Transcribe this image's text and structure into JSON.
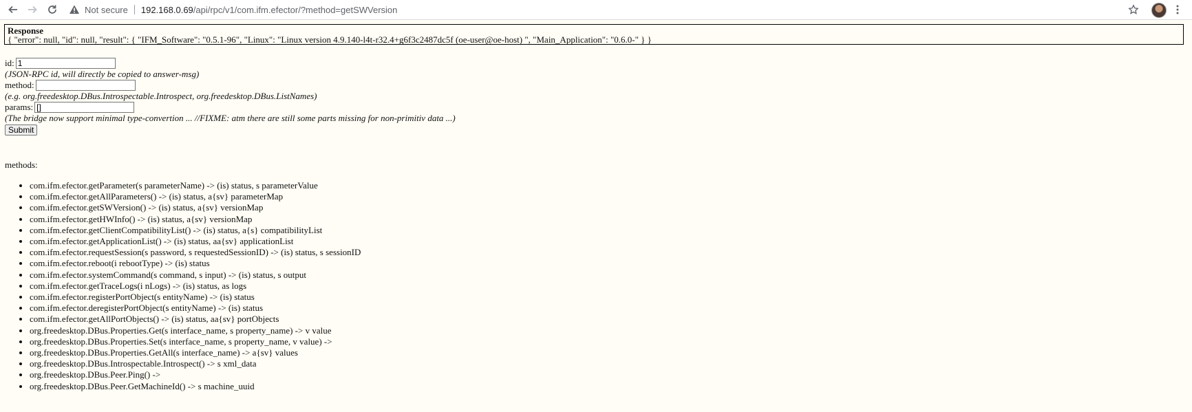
{
  "browser": {
    "security_label": "Not secure",
    "url_host": "192.168.0.69",
    "url_path": "/api/rpc/v1/com.ifm.efector/?method=getSWVersion"
  },
  "response": {
    "title": "Response",
    "body": "{ \"error\": null, \"id\": null, \"result\": { \"IFM_Software\": \"0.5.1-96\", \"Linux\": \"Linux version 4.9.140-l4t-r32.4+g6f3c2487dc5f (oe-user@oe-host) \", \"Main_Application\": \"0.6.0-\" } }"
  },
  "form": {
    "id_label": "id:",
    "id_value": "1",
    "id_hint": "(JSON-RPC id, will directly be copied to answer-msg)",
    "method_label": "method:",
    "method_value": "",
    "method_hint": "(e.g. org.freedesktop.DBus.Introspectable.Introspect, org.freedesktop.DBus.ListNames)",
    "params_label": "params:",
    "params_value": "[]",
    "params_hint": "(The bridge now support minimal type-convertion ... //FIXME: atm there are still some parts missing for non-primitiv data ...)",
    "submit_label": "Submit"
  },
  "methods": {
    "label": "methods:",
    "items": [
      "com.ifm.efector.getParameter(s parameterName) -> (is) status, s parameterValue",
      "com.ifm.efector.getAllParameters() -> (is) status, a{sv} parameterMap",
      "com.ifm.efector.getSWVersion() -> (is) status, a{sv} versionMap",
      "com.ifm.efector.getHWInfo() -> (is) status, a{sv} versionMap",
      "com.ifm.efector.getClientCompatibilityList() -> (is) status, a{s} compatibilityList",
      "com.ifm.efector.getApplicationList() -> (is) status, aa{sv} applicationList",
      "com.ifm.efector.requestSession(s password, s requestedSessionID) -> (is) status, s sessionID",
      "com.ifm.efector.reboot(i rebootType) -> (is) status",
      "com.ifm.efector.systemCommand(s command, s input) -> (is) status, s output",
      "com.ifm.efector.getTraceLogs(i nLogs) -> (is) status, as logs",
      "com.ifm.efector.registerPortObject(s entityName) -> (is) status",
      "com.ifm.efector.deregisterPortObject(s entityName) -> (is) status",
      "com.ifm.efector.getAllPortObjects() -> (is) status, aa{sv} portObjects",
      "org.freedesktop.DBus.Properties.Get(s interface_name, s property_name) -> v value",
      "org.freedesktop.DBus.Properties.Set(s interface_name, s property_name, v value) ->",
      "org.freedesktop.DBus.Properties.GetAll(s interface_name) -> a{sv} values",
      "org.freedesktop.DBus.Introspectable.Introspect() -> s xml_data",
      "org.freedesktop.DBus.Peer.Ping() ->",
      "org.freedesktop.DBus.Peer.GetMachineId() -> s machine_uuid"
    ]
  },
  "icons": {
    "back": "arrow-left-icon",
    "forward": "arrow-right-icon",
    "reload": "reload-icon",
    "security": "warning-triangle-icon",
    "bookmark": "star-icon",
    "menu": "more-vertical-icon"
  }
}
